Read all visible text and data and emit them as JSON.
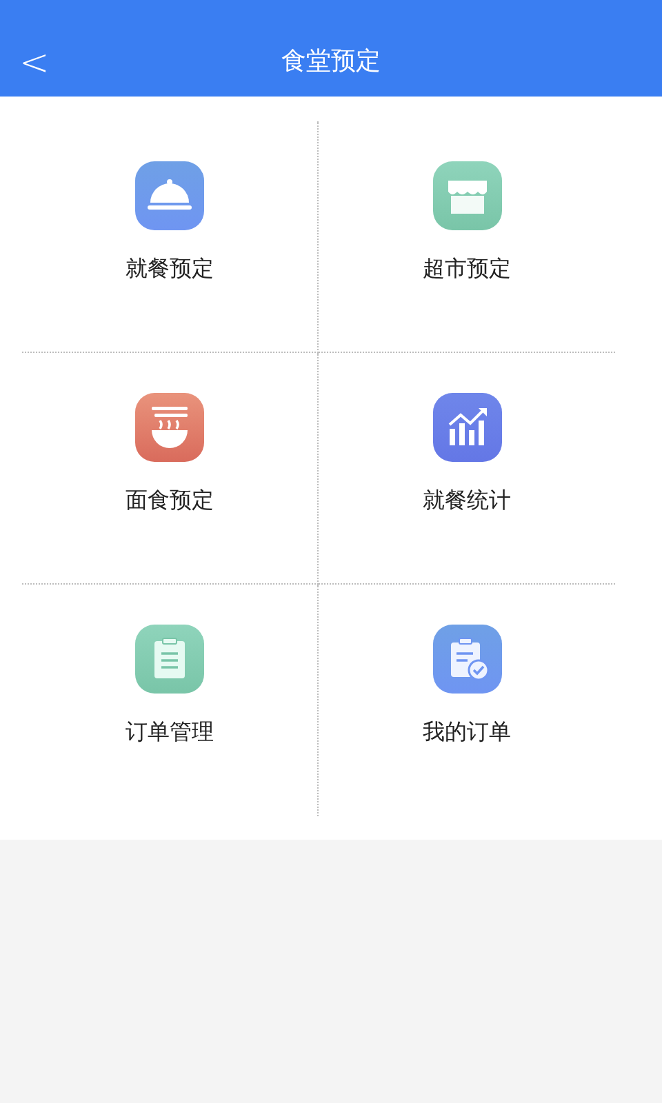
{
  "header": {
    "back": "<",
    "title": "食堂预定"
  },
  "items": [
    {
      "label": "就餐预定",
      "kind": "dining"
    },
    {
      "label": "超市预定",
      "kind": "store"
    },
    {
      "label": "面食预定",
      "kind": "noodle"
    },
    {
      "label": "就餐统计",
      "kind": "chart"
    },
    {
      "label": "订单管理",
      "kind": "clipboard"
    },
    {
      "label": "我的订单",
      "kind": "clipboard-check"
    }
  ]
}
